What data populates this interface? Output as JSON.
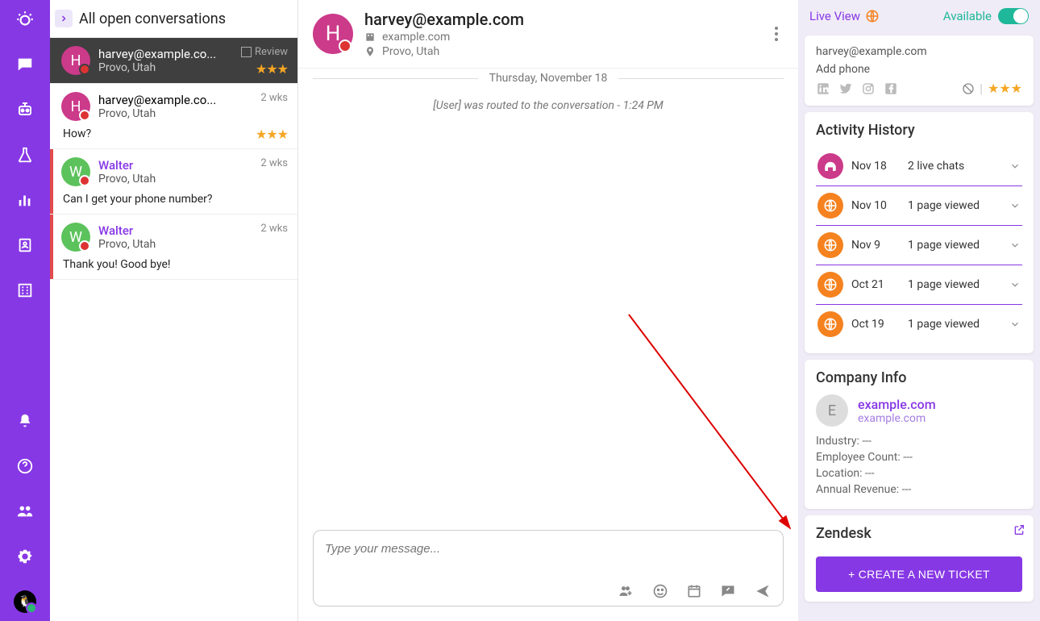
{
  "convo_header": {
    "title": "All open conversations"
  },
  "conversations": [
    {
      "initial": "H",
      "name": "harvey@example.co...",
      "sub": "Provo, Utah",
      "meta": "Review",
      "stars": "★★★",
      "preview": "",
      "active": true,
      "avatarColor": "pink",
      "bar": "",
      "metaType": "review"
    },
    {
      "initial": "H",
      "name": "harvey@example.co...",
      "sub": "Provo, Utah",
      "meta": "2 wks",
      "stars": "★★★",
      "preview": "How?",
      "active": false,
      "avatarColor": "pink",
      "bar": "",
      "metaType": "time"
    },
    {
      "initial": "W",
      "name": "Walter",
      "sub": "Provo, Utah",
      "meta": "2 wks",
      "stars": "",
      "preview": "Can I get your phone number?",
      "active": false,
      "avatarColor": "green",
      "bar": "#e24b4b",
      "metaType": "time",
      "nameLink": true
    },
    {
      "initial": "W",
      "name": "Walter",
      "sub": "Provo, Utah",
      "meta": "2 wks",
      "stars": "",
      "preview": "Thank you! Good bye!",
      "active": false,
      "avatarColor": "green",
      "bar": "#e24b4b",
      "metaType": "time",
      "nameLink": true
    }
  ],
  "chat_header": {
    "initial": "H",
    "name": "harvey@example.com",
    "domain": "example.com",
    "location": "Provo, Utah"
  },
  "chat_body": {
    "date": "Thursday, November 18",
    "routed": "[User] was routed to the conversation - 1:24 PM"
  },
  "composer": {
    "placeholder": "Type your message..."
  },
  "right_top": {
    "live": "Live View",
    "available": "Available"
  },
  "contact": {
    "email": "harvey@example.com",
    "phone": "Add phone",
    "stars": "★★★"
  },
  "activity": {
    "title": "Activity History",
    "rows": [
      {
        "icon": "pink",
        "date": "Nov 18",
        "desc": "2 live chats"
      },
      {
        "icon": "orange",
        "date": "Nov 10",
        "desc": "1 page viewed"
      },
      {
        "icon": "orange",
        "date": "Nov 9",
        "desc": "1 page viewed"
      },
      {
        "icon": "orange",
        "date": "Oct 21",
        "desc": "1 page viewed"
      },
      {
        "icon": "orange",
        "date": "Oct 19",
        "desc": "1 page viewed"
      }
    ]
  },
  "company": {
    "title": "Company Info",
    "initial": "E",
    "name": "example.com",
    "domain": "example.com",
    "industry_label": "Industry: ---",
    "employee_label": "Employee Count: ---",
    "location_label": "Location: ---",
    "revenue_label": "Annual Revenue: ---"
  },
  "zendesk": {
    "title": "Zendesk",
    "button": "+ CREATE A NEW TICKET"
  }
}
